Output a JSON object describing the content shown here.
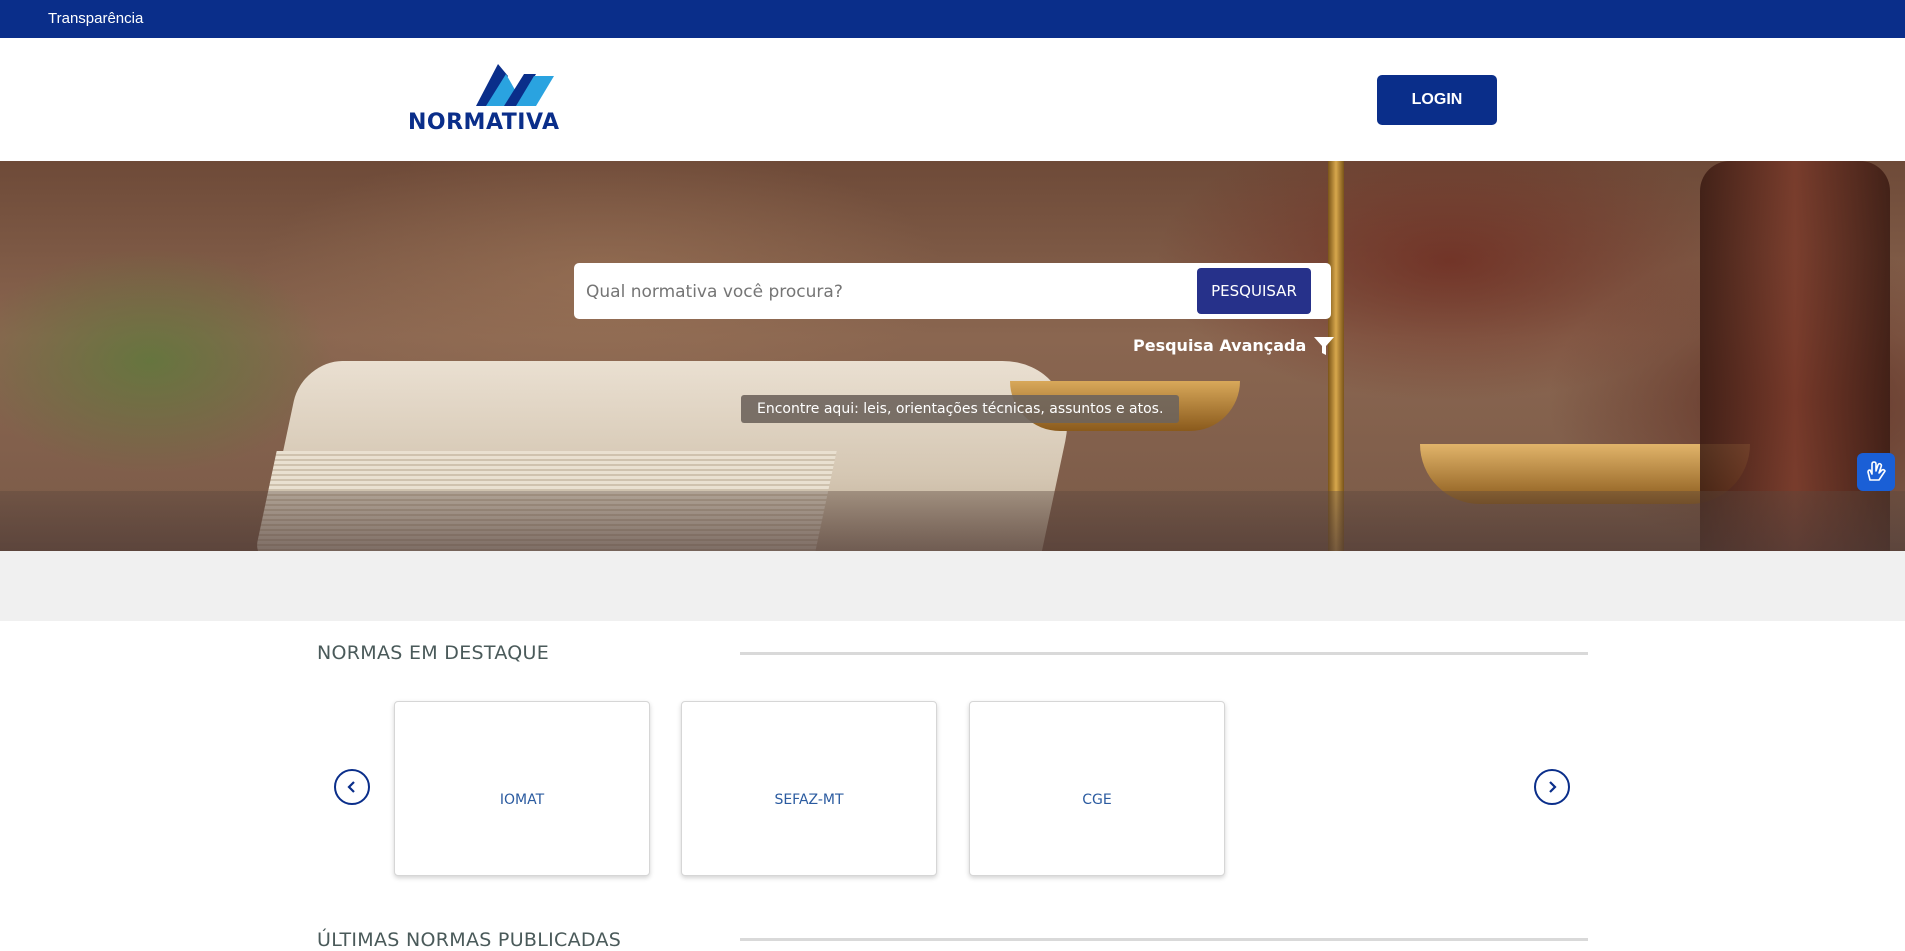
{
  "topbar": {
    "link_label": "Transparência",
    "color": "#0a2e8a"
  },
  "header": {
    "logo_text": "NORMATIVA",
    "login_label": "LOGIN"
  },
  "hero": {
    "search": {
      "placeholder": "Qual normativa você procura?",
      "button_label": "PESQUISAR"
    },
    "advanced_search_label": "Pesquisa Avançada",
    "tagline": "Encontre aqui: leis, orientações técnicas, assuntos e atos."
  },
  "accessibility": {
    "icon": "hand-sign-icon"
  },
  "featured": {
    "title": "NORMAS EM DESTAQUE",
    "cards": [
      {
        "label": "IOMAT"
      },
      {
        "label": "SEFAZ-MT"
      },
      {
        "label": "CGE"
      }
    ]
  },
  "latest": {
    "title": "ÚLTIMAS NORMAS PUBLICADAS"
  },
  "colors": {
    "primary": "#0a2e8a",
    "button": "#26318a",
    "accent_blue": "#2aa3e0",
    "card_text": "#2b5ba0"
  }
}
